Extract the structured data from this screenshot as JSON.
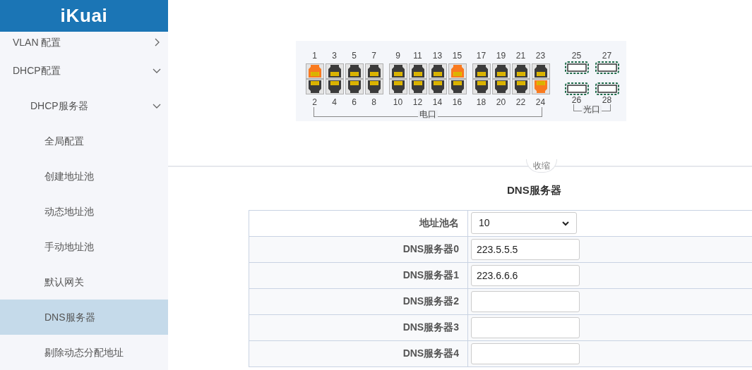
{
  "header": {
    "logo": "iKuai"
  },
  "sidebar": {
    "items": [
      {
        "label": "VLAN 配置",
        "expanded": false
      },
      {
        "label": "DHCP配置",
        "expanded": true,
        "children": [
          {
            "label": "DHCP服务器",
            "expanded": true,
            "children": [
              {
                "label": "全局配置",
                "selected": false
              },
              {
                "label": "创建地址池",
                "selected": false
              },
              {
                "label": "动态地址池",
                "selected": false
              },
              {
                "label": "手动地址池",
                "selected": false
              },
              {
                "label": "默认网关",
                "selected": false
              },
              {
                "label": "DNS服务器",
                "selected": true
              },
              {
                "label": "剔除动态分配地址",
                "selected": false
              }
            ]
          }
        ]
      }
    ]
  },
  "ports": {
    "electrical": {
      "label": "电口",
      "groups": [
        {
          "columns": [
            {
              "upper": {
                "number": "1",
                "active": true
              },
              "lower": {
                "number": "2",
                "active": false
              }
            },
            {
              "upper": {
                "number": "3",
                "active": false
              },
              "lower": {
                "number": "4",
                "active": false
              }
            },
            {
              "upper": {
                "number": "5",
                "active": false
              },
              "lower": {
                "number": "6",
                "active": false
              }
            },
            {
              "upper": {
                "number": "7",
                "active": false
              },
              "lower": {
                "number": "8",
                "active": false
              }
            }
          ]
        },
        {
          "columns": [
            {
              "upper": {
                "number": "9",
                "active": false
              },
              "lower": {
                "number": "10",
                "active": false
              }
            },
            {
              "upper": {
                "number": "11",
                "active": false
              },
              "lower": {
                "number": "12",
                "active": false
              }
            },
            {
              "upper": {
                "number": "13",
                "active": false
              },
              "lower": {
                "number": "14",
                "active": false
              }
            },
            {
              "upper": {
                "number": "15",
                "active": true
              },
              "lower": {
                "number": "16",
                "active": false
              }
            }
          ]
        },
        {
          "columns": [
            {
              "upper": {
                "number": "17",
                "active": false
              },
              "lower": {
                "number": "18",
                "active": false
              }
            },
            {
              "upper": {
                "number": "19",
                "active": false
              },
              "lower": {
                "number": "20",
                "active": false
              }
            },
            {
              "upper": {
                "number": "21",
                "active": false
              },
              "lower": {
                "number": "22",
                "active": false
              }
            },
            {
              "upper": {
                "number": "23",
                "active": false
              },
              "lower": {
                "number": "24",
                "active": true
              }
            }
          ]
        }
      ]
    },
    "optical": {
      "label": "光口",
      "columns": [
        {
          "upper": {
            "number": "25"
          },
          "lower": {
            "number": "26"
          }
        },
        {
          "upper": {
            "number": "27"
          },
          "lower": {
            "number": "28"
          }
        }
      ]
    }
  },
  "collapse": {
    "label": "收缩"
  },
  "form": {
    "title": "DNS服务器",
    "rows": [
      {
        "kind": "select",
        "label": "地址池名",
        "value": "10"
      },
      {
        "kind": "input",
        "label": "DNS服务器0",
        "value": "223.5.5.5"
      },
      {
        "kind": "input",
        "label": "DNS服务器1",
        "value": "223.6.6.6"
      },
      {
        "kind": "input",
        "label": "DNS服务器2"
      },
      {
        "kind": "input",
        "label": "DNS服务器3"
      },
      {
        "kind": "input",
        "label": "DNS服务器4"
      }
    ]
  }
}
